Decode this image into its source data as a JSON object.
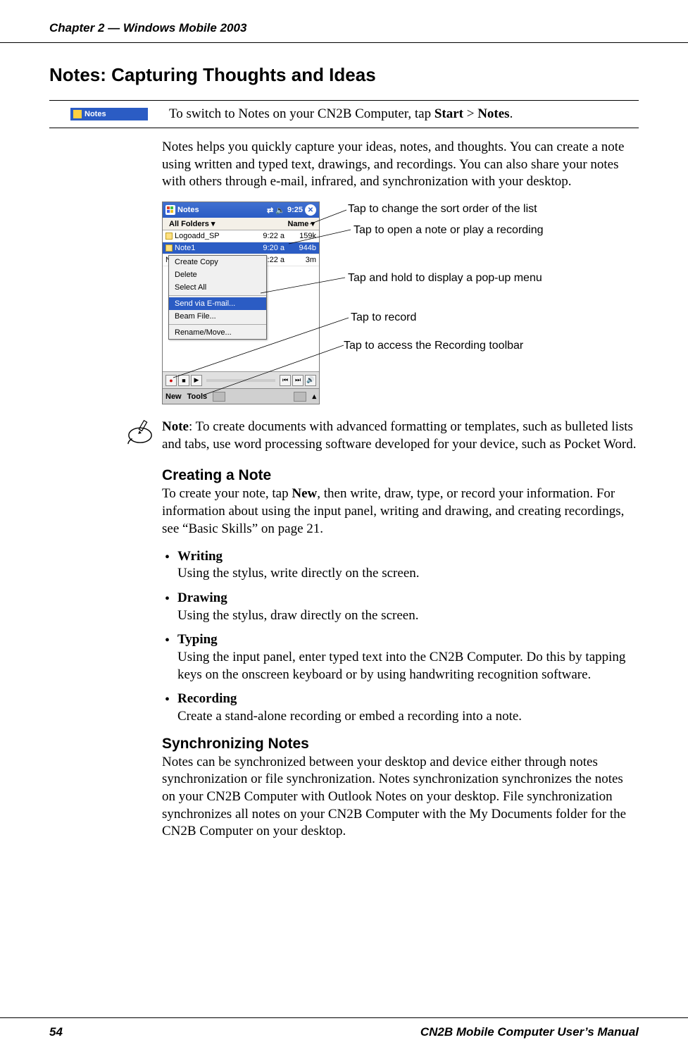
{
  "header": {
    "chapter": "Chapter 2 — Windows Mobile 2003"
  },
  "title": "Notes: Capturing Thoughts and Ideas",
  "banner": {
    "icon_label": "Notes",
    "text_pre": "To switch to Notes on your CN2B Computer, tap ",
    "bold1": "Start",
    "gt": " > ",
    "bold2": "Notes",
    "period": "."
  },
  "intro": "Notes helps you quickly capture your ideas, notes, and thoughts. You can create a note using written and typed text, drawings, and recordings. You can also share your notes with others through e-mail, infrared, and synchronization with your desktop.",
  "pda": {
    "app": "Notes",
    "time": "9:25",
    "folders_label": "All Folders",
    "sort_label": "Name",
    "rows": [
      {
        "name": "Logoadd_SP",
        "time": "9:22 a",
        "size": "159k"
      },
      {
        "name": "Note1",
        "time": "9:20 a",
        "size": "944b",
        "sel": true
      },
      {
        "name": "Note2",
        "time": "9:22 a",
        "size": "3m"
      }
    ],
    "menu": {
      "items": [
        "Create Copy",
        "Delete",
        "Select All"
      ],
      "sel": "Send via E-mail...",
      "items2": [
        "Beam File..."
      ],
      "items3": [
        "Rename/Move..."
      ]
    },
    "bottom": {
      "new": "New",
      "tools": "Tools"
    }
  },
  "callouts": {
    "c1": "Tap to change the sort order of the list",
    "c2": "Tap to open a note or play a recording",
    "c3": "Tap and hold to display a pop-up menu",
    "c4": "Tap to record",
    "c5": "Tap to access the Recording toolbar"
  },
  "note": {
    "label": "Note",
    "text": ": To create documents with advanced formatting or templates, such as bulleted lists and tabs, use word processing software developed for your device, such as Pocket Word."
  },
  "creating": {
    "heading": "Creating a Note",
    "lead_pre": "To create your note, tap ",
    "lead_bold": "New",
    "lead_post": ", then write, draw, type, or record your information. For information about using the input panel, writing and drawing, and creating recordings, see “Basic Skills” on page 21.",
    "bullets": [
      {
        "h": "Writing",
        "t": "Using the stylus, write directly on the screen."
      },
      {
        "h": "Drawing",
        "t": "Using the stylus, draw directly on the screen."
      },
      {
        "h": "Typing",
        "t": "Using the input panel, enter typed text into the CN2B Computer. Do this by tapping keys on the onscreen keyboard or by using handwriting recognition software."
      },
      {
        "h": "Recording",
        "t": "Create a stand-alone recording or embed a recording into a note."
      }
    ]
  },
  "sync": {
    "heading": "Synchronizing Notes",
    "text": "Notes can be synchronized between your desktop and device either through notes synchronization or file synchronization. Notes synchronization synchronizes the notes on your CN2B Computer with Outlook Notes on your desktop. File synchronization synchronizes all notes on your CN2B Computer with the My Documents folder for the CN2B Computer on your desktop."
  },
  "footer": {
    "page": "54",
    "manual": "CN2B Mobile Computer User’s Manual"
  }
}
